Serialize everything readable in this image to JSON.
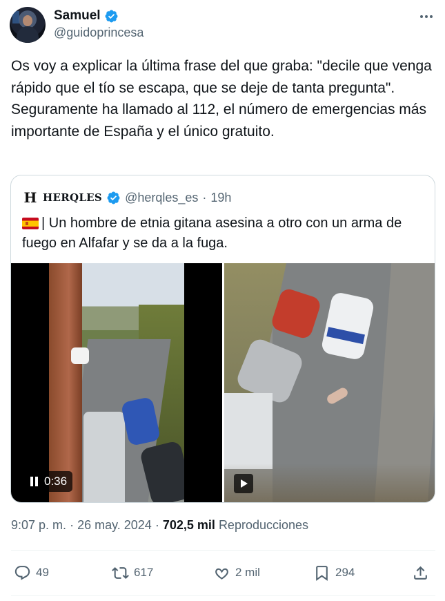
{
  "author": {
    "display_name": "Samuel",
    "handle": "@guidoprincesa"
  },
  "tweet": {
    "paragraph1": "Os voy a explicar la última frase del que graba: \"decile que venga rápido que el tío se escapa, que se deje de tanta pregunta\".",
    "paragraph2": "Seguramente ha llamado al 112, el número de emergencias más importante de España y el único gratuito."
  },
  "quote": {
    "logo": "H",
    "display_name": "HERQLES",
    "handle": "@herqles_es",
    "separator": "·",
    "time": "19h",
    "text": "| Un hombre de etnia gitana asesina a otro con un arma de fuego en Alfafar y se da a la fuga.",
    "video_duration": "0:36"
  },
  "meta": {
    "time": "9:07 p. m.",
    "separator": "·",
    "date": "26 may. 2024",
    "separator2": "·",
    "views_count": "702,5 mil",
    "views_label": "Reproducciones"
  },
  "actions": {
    "replies": "49",
    "reposts": "617",
    "likes": "2 mil",
    "bookmarks": "294"
  },
  "colors": {
    "text": "#0f1419",
    "secondary": "#536471",
    "verified": "#1d9bf0",
    "border": "#cfd9de"
  }
}
